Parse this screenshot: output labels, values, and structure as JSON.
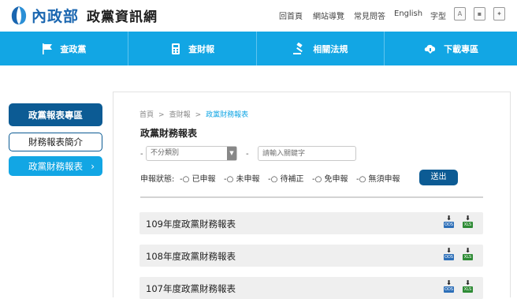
{
  "header": {
    "ministry": "內政部",
    "site_title": "政黨資訊網",
    "links": [
      "回首頁",
      "網站導覽",
      "常見問答",
      "English",
      "字型"
    ]
  },
  "nav": {
    "items": [
      {
        "label": "查政黨",
        "icon": "flag-icon"
      },
      {
        "label": "查財報",
        "icon": "calculator-icon"
      },
      {
        "label": "相關法規",
        "icon": "gavel-icon"
      },
      {
        "label": "下載專區",
        "icon": "cloud-download-icon"
      }
    ]
  },
  "sidebar": {
    "title": "政黨報表專區",
    "items": [
      {
        "label": "財務報表簡介"
      },
      {
        "label": "政黨財務報表",
        "chevron": "›"
      }
    ]
  },
  "main": {
    "breadcrumb": [
      "首頁",
      "查財報",
      "政黨財務報表"
    ],
    "breadcrumb_sep": ">",
    "title": "政黨財務報表",
    "filter": {
      "select_value": "不分類別",
      "search_placeholder": "請輸入關鍵字",
      "dash": "-"
    },
    "status": {
      "label": "申報狀態:",
      "options": [
        "已申報",
        "未申報",
        "待補正",
        "免申報",
        "無須申報"
      ]
    },
    "submit_label": "送出",
    "reports": [
      {
        "title": "109年度政黨財務報表"
      },
      {
        "title": "108年度政黨財務報表"
      },
      {
        "title": "107年度政黨財務報表"
      }
    ],
    "file_tags": {
      "ods": "ODS",
      "xls": "XLS"
    }
  },
  "colors": {
    "primary": "#12a6e4",
    "dark": "#0c5b94"
  }
}
